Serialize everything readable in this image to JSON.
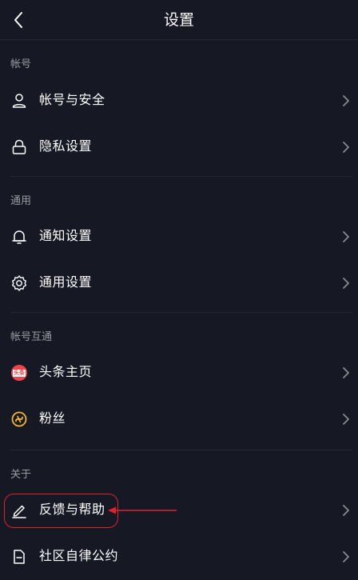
{
  "header": {
    "title": "设置",
    "back_icon": "chevron-left-icon"
  },
  "sections": [
    {
      "header": "帐号",
      "items": [
        {
          "label": "帐号与安全",
          "icon": "user-icon"
        },
        {
          "label": "隐私设置",
          "icon": "lock-icon"
        }
      ]
    },
    {
      "header": "通用",
      "items": [
        {
          "label": "通知设置",
          "icon": "bell-icon"
        },
        {
          "label": "通用设置",
          "icon": "gear-icon"
        }
      ]
    },
    {
      "header": "帐号互通",
      "items": [
        {
          "label": "头条主页",
          "icon": "toutiao-logo-icon",
          "badge_text": "头条"
        },
        {
          "label": "粉丝",
          "icon": "fans-icon"
        }
      ]
    },
    {
      "header": "关于",
      "items": [
        {
          "label": "反馈与帮助",
          "icon": "edit-pen-icon"
        },
        {
          "label": "社区自律公约",
          "icon": "document-icon"
        }
      ]
    }
  ],
  "colors": {
    "background": "#161823",
    "section_header": "#9a9ba1",
    "divider": "#262833",
    "chevron": "#8a8b91",
    "annotation": "#e0222d",
    "toutiao_red": "#f0444a",
    "fans_yellow": "#f5b731"
  }
}
